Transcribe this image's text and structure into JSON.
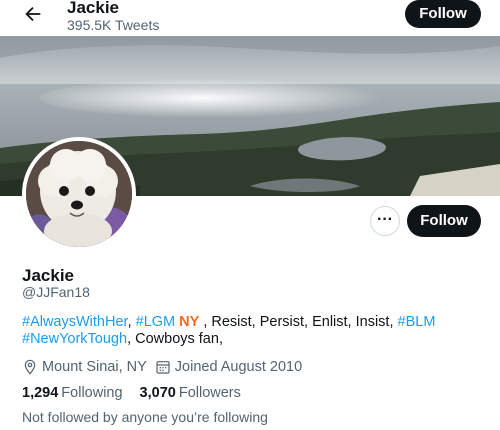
{
  "header": {
    "name": "Jackie",
    "tweet_count": "395.5K Tweets",
    "follow_label": "Follow"
  },
  "profile": {
    "display_name": "Jackie",
    "handle": "@JJFan18",
    "follow_label": "Follow",
    "more_label": "···",
    "bio": {
      "tag1": "#AlwaysWithHer",
      "sep1": ", ",
      "tag2": "#LGM",
      "emoji": " NY",
      "text1": " , Resist, Persist, Enlist, Insist, ",
      "tag3": "#BLM",
      "tag4": "#NewYorkTough",
      "text2": ", Cowboys fan,"
    },
    "location": "Mount Sinai, NY",
    "joined": "Joined August 2010",
    "following_count": "1,294",
    "following_label": "Following",
    "followers_count": "3,070",
    "followers_label": "Followers",
    "not_followed": "Not followed by anyone you’re following"
  },
  "colors": {
    "accent": "#1d9bf0",
    "button_bg": "#0f1419",
    "muted_text": "#536471"
  }
}
